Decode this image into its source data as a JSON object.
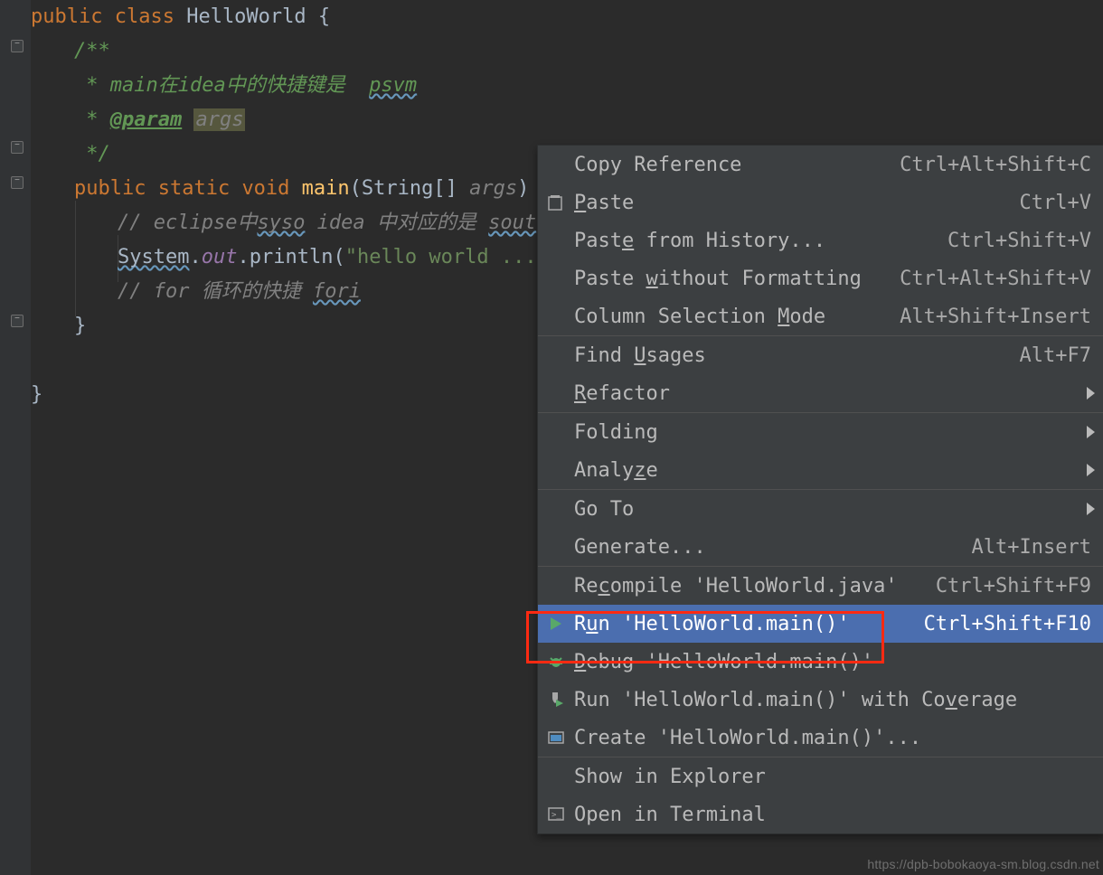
{
  "code": {
    "l1_public": "public ",
    "l1_class": "class ",
    "l1_name": "HelloWorld ",
    "l1_brace": "{",
    "l2": "/**",
    "l3_pre": " * main在idea中的快捷键是  ",
    "l3_kw": "psvm",
    "l4_pre": " * ",
    "l4_tag": "@param",
    "l4_args": "args",
    "l5": " */",
    "l6_public": "public ",
    "l6_static": "static ",
    "l6_void": "void ",
    "l6_main": "main",
    "l6_sig_open": "(",
    "l6_type": "String[] ",
    "l6_args": "args",
    "l6_sig_close": ") {",
    "l7_pre": "// eclipse中",
    "l7_syso": "syso",
    "l7_mid": " idea 中对应的是 ",
    "l7_sout": "sout",
    "l8_sys": "System",
    "l8_dot1": ".",
    "l8_out": "out",
    "l8_dot2": ".",
    "l8_println": "println",
    "l8_open": "(",
    "l8_str": "\"hello world ...\"",
    "l8_close": ");",
    "l9_pre": "// for 循环的快捷 ",
    "l9_fori": "fori",
    "l10": "}",
    "l12": "}"
  },
  "menu": {
    "copy_ref": "Copy Reference",
    "copy_ref_sc": "Ctrl+Alt+Shift+C",
    "paste": "Paste",
    "paste_sc": "Ctrl+V",
    "paste_hist": "Paste from History...",
    "paste_hist_sc": "Ctrl+Shift+V",
    "paste_nofmt": "Paste without Formatting",
    "paste_nofmt_sc": "Ctrl+Alt+Shift+V",
    "colsel": "Column Selection Mode",
    "colsel_sc": "Alt+Shift+Insert",
    "find_usages": "Find Usages",
    "find_usages_sc": "Alt+F7",
    "refactor": "Refactor",
    "folding": "Folding",
    "analyze": "Analyze",
    "goto": "Go To",
    "generate": "Generate...",
    "generate_sc": "Alt+Insert",
    "recompile": "Recompile 'HelloWorld.java'",
    "recompile_sc": "Ctrl+Shift+F9",
    "run": "Run 'HelloWorld.main()'",
    "run_sc": "Ctrl+Shift+F10",
    "debug": "Debug 'HelloWorld.main()'",
    "coverage": "Run 'HelloWorld.main()' with Coverage",
    "create": "Create 'HelloWorld.main()'...",
    "show_explorer": "Show in Explorer",
    "open_terminal": "Open in Terminal"
  },
  "watermark": "https://dpb-bobokaoya-sm.blog.csdn.net"
}
